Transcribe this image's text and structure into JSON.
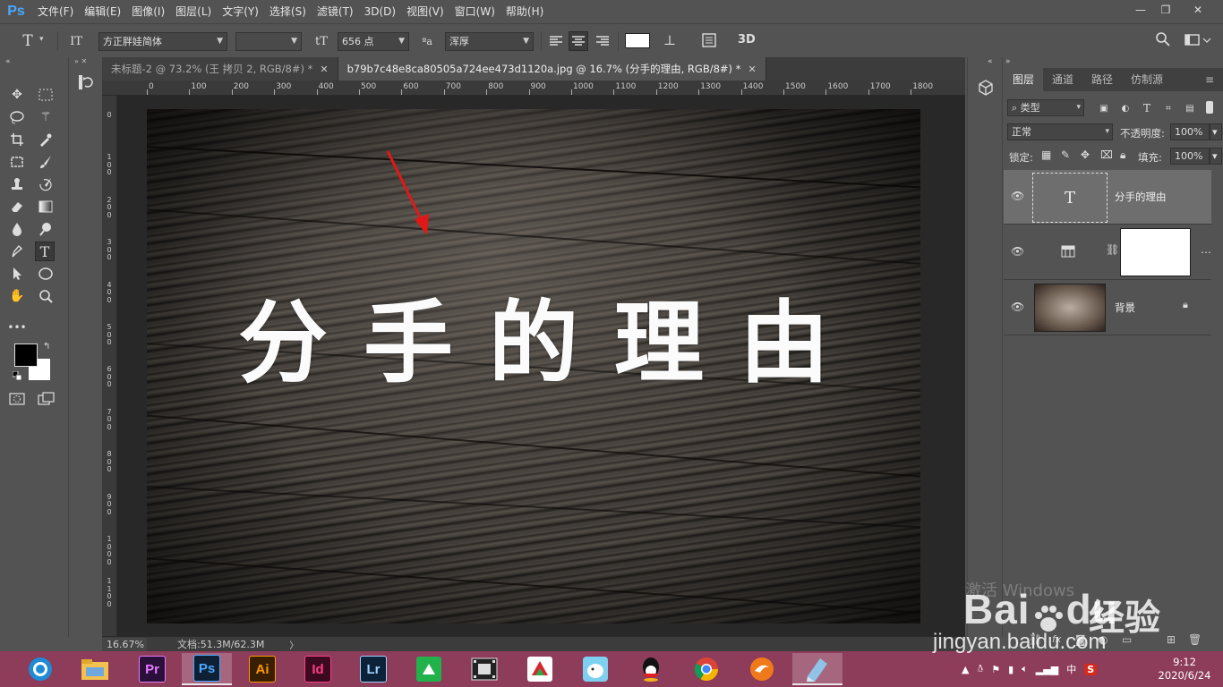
{
  "app": {
    "logo": "Ps",
    "menu": [
      "文件(F)",
      "编辑(E)",
      "图像(I)",
      "图层(L)",
      "文字(Y)",
      "选择(S)",
      "滤镜(T)",
      "3D(D)",
      "视图(V)",
      "窗口(W)",
      "帮助(H)"
    ],
    "window_controls": {
      "minimize": "—",
      "restore": "❐",
      "close": "✕"
    }
  },
  "options": {
    "tool_icon": "T",
    "orient_icon": "IT",
    "font_family": "方正胖娃简体",
    "font_style": "",
    "size_icon": "tT",
    "font_size": "656 点",
    "aa_icon": "ªa",
    "antialias": "浑厚",
    "color_swatch": "#ffffff",
    "threed": "3D"
  },
  "tabs": [
    {
      "label": "未标题-2 @ 73.2% (王 拷贝 2, RGB/8#) *",
      "close": "✕"
    },
    {
      "label": "b79b7c48e8ca80505a724ee473d1120a.jpg @ 16.7% (分手的理由, RGB/8#) *",
      "close": "✕"
    }
  ],
  "ruler": {
    "top": [
      "0",
      "100",
      "200",
      "300",
      "400",
      "500",
      "600",
      "700",
      "800",
      "900",
      "1000",
      "1100",
      "1200",
      "1300",
      "1400",
      "1500",
      "1600",
      "1700",
      "1800"
    ],
    "left": [
      "0",
      "100",
      "200",
      "300",
      "400",
      "500",
      "600",
      "700",
      "800",
      "900",
      "1000",
      "1100"
    ]
  },
  "canvas": {
    "title": "分手的理由"
  },
  "status": {
    "zoom": "16.67%",
    "doc_info": "文档:51.3M/62.3M",
    "arrow": "〉"
  },
  "layers_panel": {
    "tabs": [
      "图层",
      "通道",
      "路径",
      "仿制源"
    ],
    "menu_icon": "≡",
    "filter_kind": "类型",
    "blend_mode": "正常",
    "opacity_label": "不透明度:",
    "opacity": "100%",
    "lock_label": "锁定:",
    "fill_label": "填充:",
    "fill": "100%",
    "layers": [
      {
        "name": "分手的理由",
        "type": "text",
        "thumb": "T",
        "selected": true
      },
      {
        "name": "",
        "type": "adjustment",
        "thumb": "",
        "selected": false
      },
      {
        "name": "背景",
        "type": "image",
        "thumb": "",
        "selected": false,
        "locked": true
      }
    ]
  },
  "taskbar": {
    "apps": [
      {
        "name": "browser",
        "label": ""
      },
      {
        "name": "file-explorer",
        "label": ""
      },
      {
        "name": "premiere",
        "label": "Pr",
        "color": "#e77bff",
        "bg": "#2a0f3b"
      },
      {
        "name": "photoshop",
        "label": "Ps",
        "color": "#4aa8ff",
        "bg": "#0e2134",
        "active": true
      },
      {
        "name": "illustrator",
        "label": "Ai",
        "color": "#ff9a00",
        "bg": "#3a1e00"
      },
      {
        "name": "indesign",
        "label": "Id",
        "color": "#ff3c8a",
        "bg": "#3b0a1f"
      },
      {
        "name": "lightroom",
        "label": "Lr",
        "color": "#9fd3ff",
        "bg": "#0b2238"
      },
      {
        "name": "green-app",
        "label": ""
      },
      {
        "name": "video-app",
        "label": ""
      },
      {
        "name": "game-app",
        "label": ""
      },
      {
        "name": "bird-app",
        "label": ""
      },
      {
        "name": "qq",
        "label": ""
      },
      {
        "name": "chrome",
        "label": ""
      },
      {
        "name": "orange-app",
        "label": ""
      },
      {
        "name": "notes-app",
        "label": ""
      }
    ],
    "tray": {
      "ime": "中",
      "sogou": "S"
    },
    "time": "9:12",
    "date": "2020/6/24"
  },
  "watermark": {
    "activate": "激活 Windows",
    "baidu": "Bai",
    "du": "du",
    "jingyan": "经验",
    "url": "jingyan.baidu.com"
  }
}
